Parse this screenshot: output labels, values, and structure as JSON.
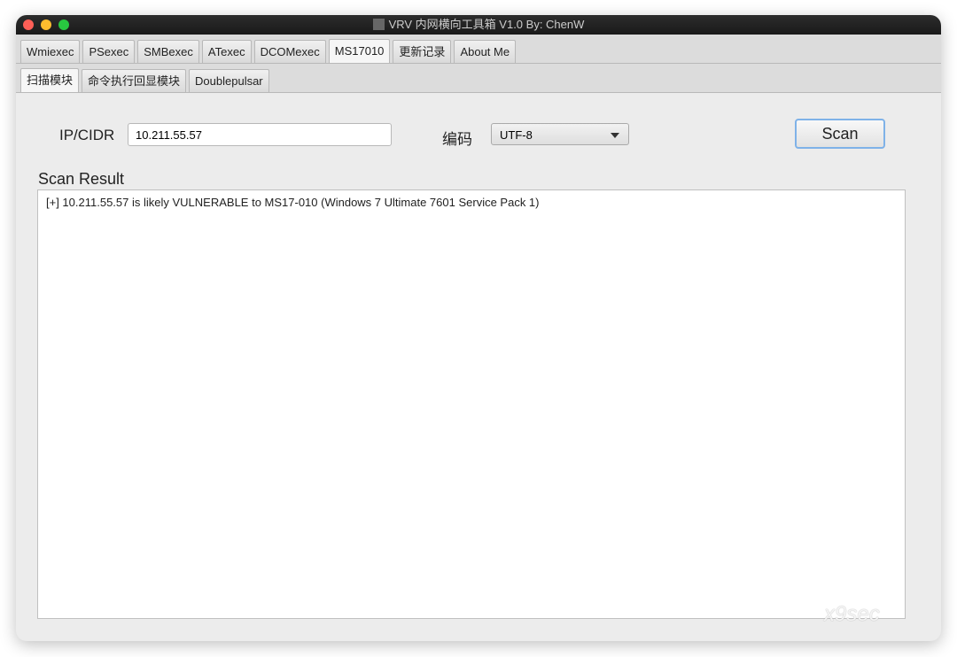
{
  "window": {
    "title": "VRV 内网横向工具箱 V1.0 By: ChenW"
  },
  "main_tabs": [
    {
      "label": "Wmiexec"
    },
    {
      "label": "PSexec"
    },
    {
      "label": "SMBexec"
    },
    {
      "label": "ATexec"
    },
    {
      "label": "DCOMexec"
    },
    {
      "label": "MS17010",
      "selected": true
    },
    {
      "label": "更新记录"
    },
    {
      "label": "About Me"
    }
  ],
  "sub_tabs": [
    {
      "label": "扫描模块",
      "selected": true
    },
    {
      "label": "命令执行回显模块"
    },
    {
      "label": "Doublepulsar"
    }
  ],
  "form": {
    "ip_label": "IP/CIDR",
    "ip_value": "10.211.55.57",
    "encoding_label": "编码",
    "encoding_value": "UTF-8",
    "scan_label": "Scan"
  },
  "result": {
    "label": "Scan Result",
    "text": "[+] 10.211.55.57 is likely VULNERABLE to MS17-010  (Windows 7 Ultimate 7601 Service Pack 1)"
  },
  "watermark": "x9sec",
  "colors": {
    "close": "#fe5f57",
    "minimize": "#febc2e",
    "zoom": "#28c840",
    "focus": "#7fb2e8"
  }
}
